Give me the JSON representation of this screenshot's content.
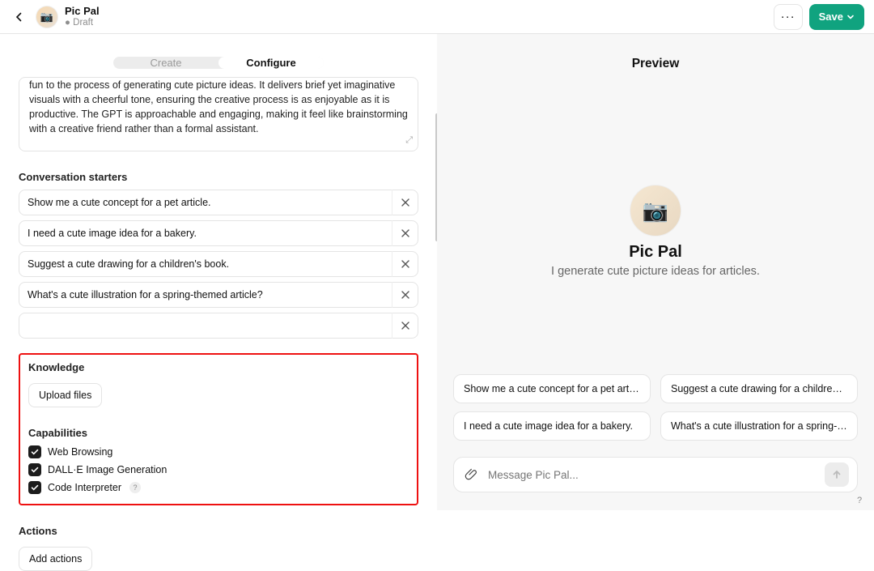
{
  "header": {
    "title": "Pic Pal",
    "subtitle": "● Draft",
    "menu": "···",
    "save_label": "Save",
    "avatar_emoji": "📷"
  },
  "tabs": {
    "create": "Create",
    "configure": "Configure"
  },
  "description": {
    "visible_text": "fun to the process of generating cute picture ideas. It delivers brief yet imaginative visuals with a cheerful tone, ensuring the creative process is as enjoyable as it is productive. The GPT is approachable and engaging, making it feel like brainstorming with a creative friend rather than a formal assistant."
  },
  "sections": {
    "starters_label": "Conversation starters",
    "knowledge_label": "Knowledge",
    "upload_label": "Upload files",
    "capabilities_label": "Capabilities",
    "actions_label": "Actions",
    "add_actions_label": "Add actions"
  },
  "starters": [
    "Show me a cute concept for a pet article.",
    "I need a cute image idea for a bakery.",
    "Suggest a cute drawing for a children's book.",
    "What's a cute illustration for a spring-themed article?",
    ""
  ],
  "capabilities": [
    {
      "label": "Web Browsing",
      "checked": true
    },
    {
      "label": "DALL·E Image Generation",
      "checked": true
    },
    {
      "label": "Code Interpreter",
      "checked": true,
      "info": true
    }
  ],
  "preview": {
    "heading": "Preview",
    "name": "Pic Pal",
    "tagline": "I generate cute picture ideas for articles.",
    "avatar_emoji": "📷",
    "chips": [
      "Show me a cute concept for a pet article.",
      "Suggest a cute drawing for a children's book.",
      "I need a cute image idea for a bakery.",
      "What's a cute illustration for a spring-themed..."
    ],
    "placeholder": "Message Pic Pal..."
  }
}
